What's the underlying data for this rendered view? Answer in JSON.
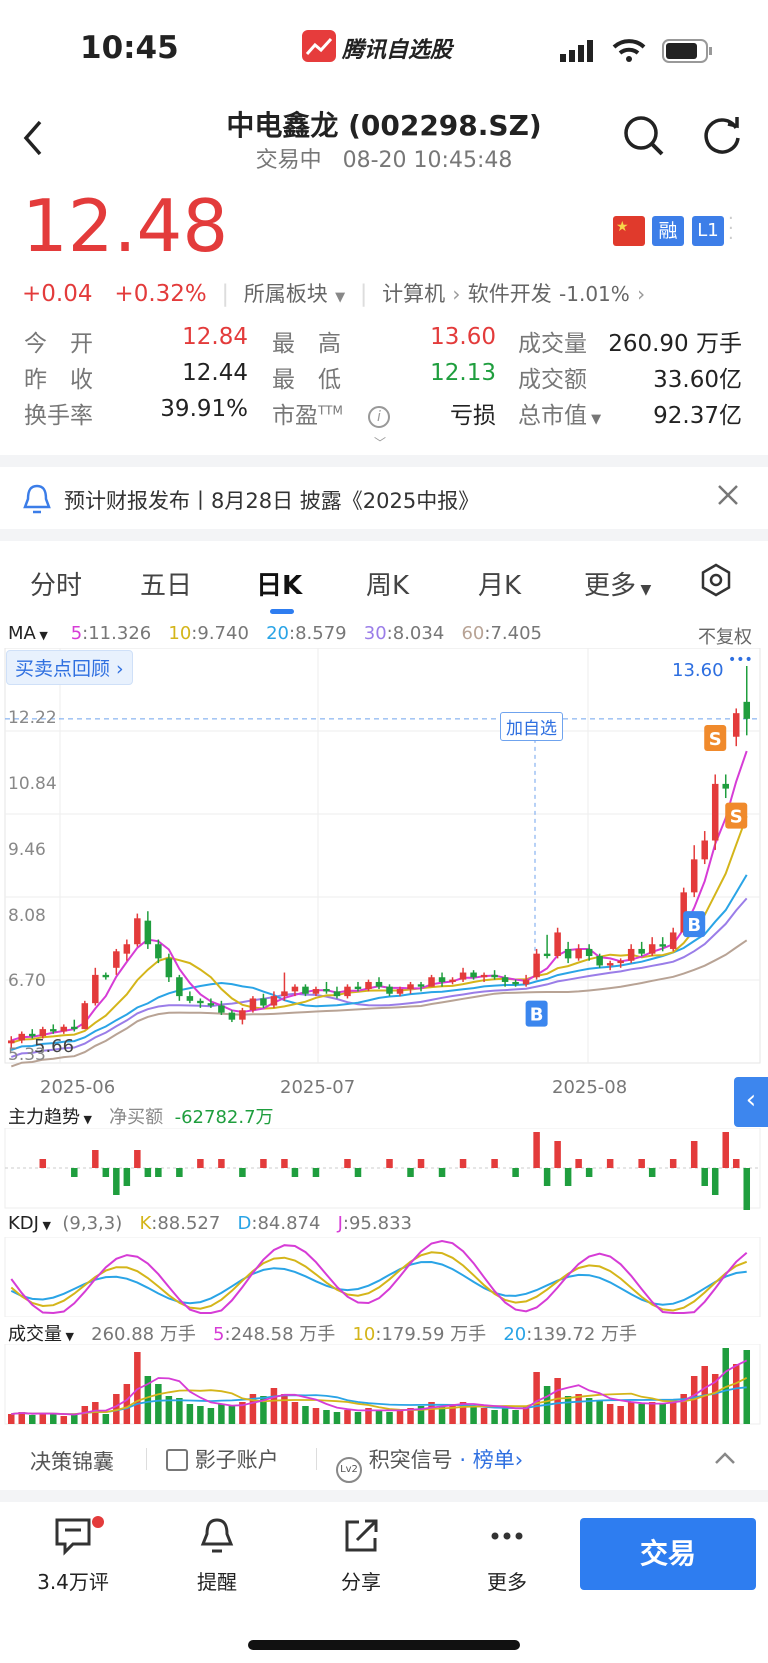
{
  "status_bar": {
    "time": "10:45",
    "app_name": "腾讯自选股"
  },
  "header": {
    "title": "中电鑫龙 (002298.SZ)",
    "status": "交易中",
    "datetime": "08-20 10:45:48"
  },
  "quote": {
    "price": "12.48",
    "change": "+0.04",
    "change_pct": "+0.32%",
    "sector_label": "所属板块",
    "sector1": "计算机",
    "sector2": "软件开发",
    "sector2_change": "-1.01%",
    "badges": {
      "rong": "融",
      "l1": "L1"
    }
  },
  "stats": {
    "open_label": "今　开",
    "open": "12.84",
    "high_label": "最　高",
    "high": "13.60",
    "volume_label": "成交量",
    "volume": "260.90 万手",
    "prev_label": "昨　收",
    "prev": "12.44",
    "low_label": "最　低",
    "low": "12.13",
    "amount_label": "成交额",
    "amount": "33.60亿",
    "turnover_label": "换手率",
    "turnover": "39.91%",
    "pe_label": "市盈",
    "pe_sup": "TTM",
    "pe": "亏损",
    "mcap_label": "总市值",
    "mcap": "92.37亿"
  },
  "notice": {
    "text": "预计财报发布丨8月28日 披露《2025中报》"
  },
  "tabs": [
    "分时",
    "五日",
    "日K",
    "周K",
    "月K",
    "更多"
  ],
  "ma_line": {
    "label": "MA",
    "ma5_k": "5",
    "ma5": "11.326",
    "ma10_k": "10",
    "ma10": "9.740",
    "ma20_k": "20",
    "ma20": "8.579",
    "ma30_k": "30",
    "ma30": "8.034",
    "ma60_k": "60",
    "ma60": "7.405",
    "adjust": "不复权"
  },
  "chart": {
    "review_btn": "买卖点回顾",
    "add_watch": "加自选",
    "y_labels": [
      "12.22",
      "10.84",
      "9.46",
      "8.08",
      "6.70",
      "5.33"
    ],
    "high_label": "13.60",
    "low_label": "5.66",
    "x_labels": [
      "2025-06",
      "2025-07",
      "2025-08"
    ]
  },
  "chart_data": {
    "type": "candlestick",
    "price_range": [
      5.33,
      13.6
    ],
    "candles": [
      [
        5.6,
        5.75,
        5.5,
        5.66
      ],
      [
        5.66,
        5.85,
        5.6,
        5.8
      ],
      [
        5.8,
        5.9,
        5.7,
        5.75
      ],
      [
        5.75,
        5.95,
        5.7,
        5.9
      ],
      [
        5.9,
        6.0,
        5.8,
        5.85
      ],
      [
        5.85,
        6.0,
        5.8,
        5.95
      ],
      [
        5.95,
        6.1,
        5.85,
        5.9
      ],
      [
        5.9,
        6.5,
        5.9,
        6.45
      ],
      [
        6.45,
        7.2,
        6.4,
        7.05
      ],
      [
        7.05,
        7.1,
        6.95,
        7.0
      ],
      [
        7.2,
        7.6,
        7.05,
        7.55
      ],
      [
        7.5,
        7.8,
        7.35,
        7.7
      ],
      [
        7.7,
        8.35,
        7.65,
        8.25
      ],
      [
        8.2,
        8.4,
        7.6,
        7.7
      ],
      [
        7.7,
        7.8,
        7.3,
        7.4
      ],
      [
        7.4,
        7.5,
        6.9,
        7.0
      ],
      [
        7.0,
        7.05,
        6.5,
        6.6
      ],
      [
        6.6,
        6.7,
        6.45,
        6.5
      ],
      [
        6.5,
        6.55,
        6.35,
        6.45
      ],
      [
        6.45,
        6.55,
        6.35,
        6.4
      ],
      [
        6.4,
        6.5,
        6.2,
        6.25
      ],
      [
        6.25,
        6.3,
        6.05,
        6.1
      ],
      [
        6.1,
        6.35,
        6.0,
        6.3
      ],
      [
        6.3,
        6.6,
        6.25,
        6.55
      ],
      [
        6.55,
        6.65,
        6.35,
        6.4
      ],
      [
        6.4,
        6.7,
        6.35,
        6.6
      ],
      [
        6.6,
        7.1,
        6.5,
        6.7
      ],
      [
        6.7,
        6.85,
        6.6,
        6.8
      ],
      [
        6.8,
        6.85,
        6.6,
        6.65
      ],
      [
        6.65,
        6.8,
        6.6,
        6.75
      ],
      [
        6.75,
        6.9,
        6.65,
        6.7
      ],
      [
        6.7,
        6.8,
        6.55,
        6.6
      ],
      [
        6.6,
        6.85,
        6.55,
        6.8
      ],
      [
        6.8,
        6.9,
        6.7,
        6.75
      ],
      [
        6.75,
        6.95,
        6.7,
        6.9
      ],
      [
        6.9,
        7.0,
        6.75,
        6.8
      ],
      [
        6.8,
        6.85,
        6.6,
        6.65
      ],
      [
        6.65,
        6.8,
        6.6,
        6.75
      ],
      [
        6.75,
        6.9,
        6.65,
        6.85
      ],
      [
        6.85,
        6.9,
        6.7,
        6.8
      ],
      [
        6.8,
        7.05,
        6.8,
        7.0
      ],
      [
        7.0,
        7.1,
        6.8,
        6.9
      ],
      [
        6.9,
        7.0,
        6.85,
        6.95
      ],
      [
        6.95,
        7.2,
        6.9,
        7.1
      ],
      [
        7.1,
        7.15,
        6.95,
        7.0
      ],
      [
        7.0,
        7.1,
        6.9,
        7.05
      ],
      [
        7.05,
        7.15,
        6.95,
        7.0
      ],
      [
        7.0,
        7.05,
        6.8,
        6.9
      ],
      [
        6.9,
        6.95,
        6.8,
        6.85
      ],
      [
        6.85,
        7.05,
        6.8,
        6.95
      ],
      [
        7.0,
        7.6,
        6.95,
        7.5
      ],
      [
        7.5,
        7.9,
        7.4,
        7.45
      ],
      [
        7.45,
        8.05,
        7.4,
        7.95
      ],
      [
        7.6,
        7.75,
        7.3,
        7.4
      ],
      [
        7.4,
        7.7,
        7.35,
        7.6
      ],
      [
        7.6,
        7.7,
        7.35,
        7.45
      ],
      [
        7.45,
        7.5,
        7.2,
        7.25
      ],
      [
        7.25,
        7.35,
        7.15,
        7.3
      ],
      [
        7.3,
        7.4,
        7.2,
        7.35
      ],
      [
        7.35,
        7.7,
        7.3,
        7.6
      ],
      [
        7.6,
        7.75,
        7.45,
        7.5
      ],
      [
        7.5,
        7.85,
        7.45,
        7.7
      ],
      [
        7.7,
        7.85,
        7.55,
        7.65
      ],
      [
        7.6,
        8.05,
        7.55,
        7.95
      ],
      [
        7.95,
        8.9,
        7.9,
        8.8
      ],
      [
        8.8,
        9.8,
        8.7,
        9.5
      ],
      [
        9.5,
        10.1,
        9.4,
        9.9
      ],
      [
        9.9,
        11.3,
        9.7,
        11.1
      ],
      [
        11.1,
        11.3,
        10.8,
        11.0
      ],
      [
        12.1,
        12.7,
        11.9,
        12.6
      ],
      [
        12.84,
        13.6,
        12.13,
        12.48
      ]
    ],
    "ma_values": {
      "ma5": 11.326,
      "ma10": 9.74,
      "ma20": 8.579,
      "ma30": 8.034,
      "ma60": 7.405
    },
    "markers": [
      {
        "type": "buy",
        "label": "B"
      },
      {
        "type": "buy",
        "label": "B"
      },
      {
        "type": "sell",
        "label": "S"
      },
      {
        "type": "sell",
        "label": "S"
      }
    ],
    "x_labels": [
      "2025-06",
      "2025-07",
      "2025-08"
    ]
  },
  "main_force": {
    "label": "主力趋势",
    "net_label": "净买额",
    "net_value": "-62782.7万"
  },
  "kdj": {
    "label": "KDJ",
    "params": "(9,3,3)",
    "k_key": "K",
    "k": "88.527",
    "d_key": "D",
    "d": "84.874",
    "j_key": "J",
    "j": "95.833"
  },
  "volume": {
    "label": "成交量",
    "value": "260.88 万手",
    "v5_k": "5",
    "v5": "248.58 万手",
    "v10_k": "10",
    "v10": "179.59 万手",
    "v20_k": "20",
    "v20": "139.72 万手"
  },
  "tools": {
    "t1": "决策锦囊",
    "t2": "影子账户",
    "t3": "积突信号",
    "t3b": "榜单"
  },
  "bottom_nav": {
    "comments": "3.4万评",
    "remind": "提醒",
    "share": "分享",
    "more": "更多",
    "trade": "交易"
  },
  "colors": {
    "up": "#e33b3b",
    "down": "#1f9e3e",
    "ma5": "#d63cd6",
    "ma10": "#d4b51a",
    "ma20": "#2aa4e6",
    "ma30": "#9a7de8",
    "ma60": "#b8a395",
    "accent": "#2e7df0"
  }
}
